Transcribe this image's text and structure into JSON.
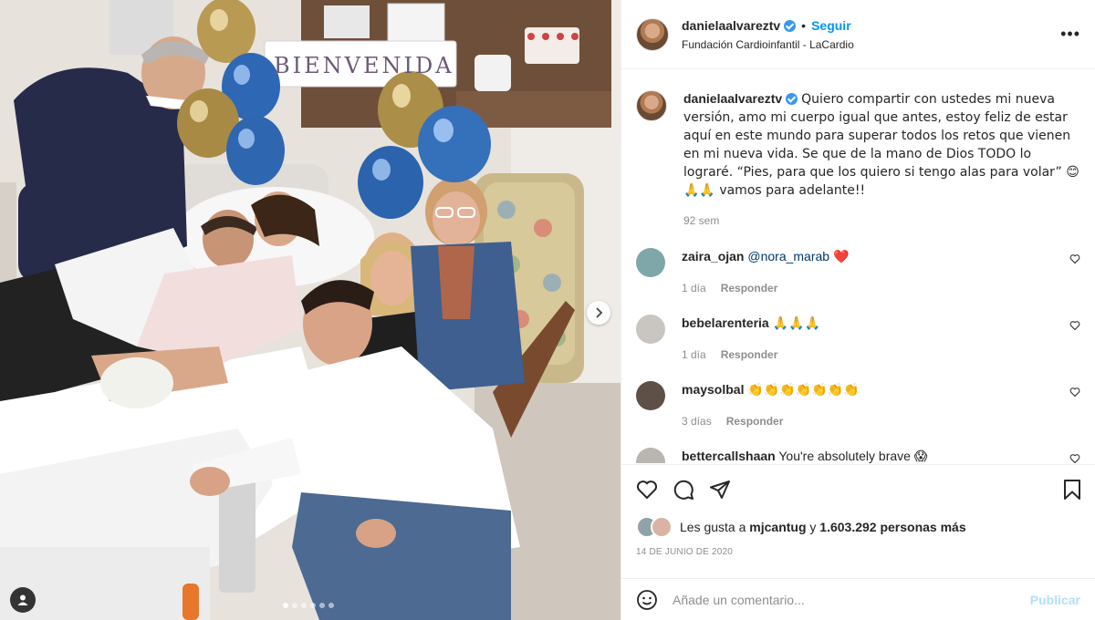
{
  "post": {
    "username": "danielaalvareztv",
    "follow_label": "Seguir",
    "separator": "•",
    "location": "Fundación Cardioinfantil - LaCardio",
    "more_label": "•••",
    "caption_text": "Quiero compartir con ustedes mi nueva versión, amo mi cuerpo igual que antes, estoy feliz de estar aquí en este mundo para superar todos los retos que vienen en mi nueva vida. Se que de la mano de Dios TODO lo lograré. “Pies, para que los quiero si tengo alas para volar” 😊🙏🙏 vamos para adelante!!",
    "caption_time": "92 sem",
    "banner_text": "BIENVENIDA",
    "carousel": {
      "slides": 6,
      "active": 1
    }
  },
  "comments": [
    {
      "user": "zaira_ojan",
      "text": "@nora_marab",
      "emoji": "❤️",
      "time": "1 día",
      "reply": "Responder",
      "color": "#7fa6a8"
    },
    {
      "user": "bebelarenteria",
      "text": "",
      "emoji": "🙏🙏🙏",
      "time": "1 día",
      "reply": "Responder",
      "color": "#c9c5c0"
    },
    {
      "user": "maysolbal",
      "text": "",
      "emoji": "👏👏👏👏👏👏👏",
      "time": "3 días",
      "reply": "Responder",
      "color": "#5e4f47"
    },
    {
      "user": "bettercallshaan",
      "text": "You're absolutely brave",
      "emoji": "😱",
      "time": "",
      "reply": "",
      "color": "#b9b5b0"
    }
  ],
  "likes": {
    "prefix": "Les gusta a",
    "first_user": "mjcantug",
    "connector": "y",
    "count": "1.603.292 personas más"
  },
  "date": "14 DE JUNIO DE 2020",
  "add_comment": {
    "placeholder": "Añade un comentario...",
    "publish": "Publicar"
  },
  "icons": {
    "like": "heart-icon",
    "comment": "comment-icon",
    "share": "share-icon",
    "save": "bookmark-icon",
    "emoji": "smiley-icon",
    "next": "chevron-right-icon",
    "tag": "user-tag-icon",
    "verified": "verified-badge-icon"
  },
  "colors": {
    "link": "#0095f6",
    "publish_disabled": "#b2dffc",
    "muted": "#8e8e8e",
    "heart": "#ed4956"
  }
}
